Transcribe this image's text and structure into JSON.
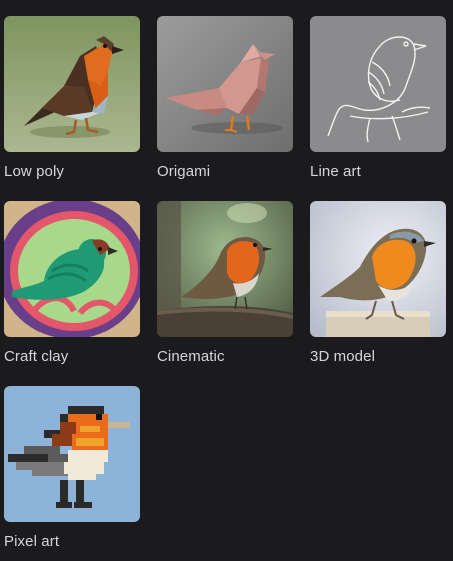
{
  "styles": [
    {
      "key": "low-poly",
      "label": "Low poly",
      "icon": "low-poly-robin-thumbnail"
    },
    {
      "key": "origami",
      "label": "Origami",
      "icon": "origami-bird-thumbnail"
    },
    {
      "key": "line-art",
      "label": "Line art",
      "icon": "line-art-bird-thumbnail"
    },
    {
      "key": "craft-clay",
      "label": "Craft clay",
      "icon": "clay-bird-thumbnail"
    },
    {
      "key": "cinematic",
      "label": "Cinematic",
      "icon": "cinematic-robin-thumbnail"
    },
    {
      "key": "3d-model",
      "label": "3D model",
      "icon": "3d-robin-thumbnail"
    },
    {
      "key": "pixel-art",
      "label": "Pixel art",
      "icon": "pixel-robin-thumbnail"
    }
  ],
  "colors": {
    "background": "#1b1b1d",
    "label": "#d6d6d8"
  }
}
